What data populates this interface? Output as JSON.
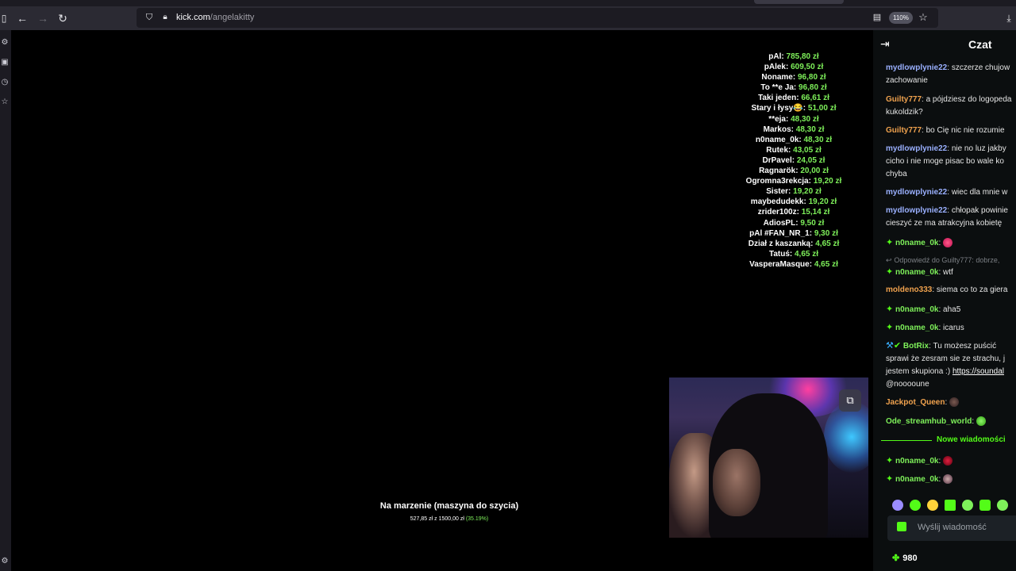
{
  "browser": {
    "url_domain": "kick.com",
    "url_path": "/angelakitty",
    "zoom": "110%",
    "icons": [
      "sidebar-toggle-icon",
      "back-icon",
      "forward-icon",
      "reload-icon",
      "tracking-shield-icon",
      "lock-icon",
      "reader-view-icon",
      "bookmark-star-icon",
      "downloads-icon"
    ]
  },
  "stream": {
    "donations": [
      {
        "name": "pAl:",
        "amount": "785,80 zł"
      },
      {
        "name": "pAlek:",
        "amount": "609,50 zł"
      },
      {
        "name": "Noname:",
        "amount": "96,80 zł"
      },
      {
        "name": "To **e Ja:",
        "amount": "96,80 zł"
      },
      {
        "name": "Taki jeden:",
        "amount": "66,61 zł"
      },
      {
        "name": "Stary i łysy😂:",
        "amount": "51,00 zł"
      },
      {
        "name": "**eja:",
        "amount": "48,30 zł"
      },
      {
        "name": "Markos:",
        "amount": "48,30 zł"
      },
      {
        "name": "n0name_0k:",
        "amount": "48,30 zł"
      },
      {
        "name": "Rutek:",
        "amount": "43,05 zł"
      },
      {
        "name": "DrPavel:",
        "amount": "24,05 zł"
      },
      {
        "name": "Ragnarök:",
        "amount": "20,00 zł"
      },
      {
        "name": "Ogromna3rekcja:",
        "amount": "19,20 zł"
      },
      {
        "name": "Sister:",
        "amount": "19,20 zł"
      },
      {
        "name": "maybedudekk:",
        "amount": "19,20 zł"
      },
      {
        "name": "zrider100z:",
        "amount": "15,14 zł"
      },
      {
        "name": "AdiosPL:",
        "amount": "9,50 zł"
      },
      {
        "name": "pAl #FAN_NR_1:",
        "amount": "9,30 zł"
      },
      {
        "name": "Dział z kaszanką:",
        "amount": "4,65 zł"
      },
      {
        "name": "Tatuś:",
        "amount": "4,65 zł"
      },
      {
        "name": "VasperaMasque:",
        "amount": "4,65 zł"
      }
    ],
    "goal": {
      "title": "Na marzenie (maszyna do szycia)",
      "progress_text": "527,85 zł z 1500,00 zł",
      "percent_text": "(35.19%)",
      "progress": 0.3519
    }
  },
  "chat": {
    "title": "Czat",
    "messages": {
      "m1_user": "mydlowplynie22",
      "m1_text1": "szczerze chujow",
      "m1_text2": "zachowanie",
      "m2_user": "Guilty777",
      "m2_text1": "a pójdziesz do logopeda",
      "m2_text2": "kukoldzik?",
      "m3_user": "Guilty777",
      "m3_text1": "bo Cię nic nie rozumie",
      "m4_user": "mydlowplynie22",
      "m4_text1": "nie no luz jakby",
      "m4_text2": "cicho i nie moge pisac bo wale ko",
      "m4_text3": "chyba",
      "m5_user": "mydlowplynie22",
      "m5_text1": "wiec dla mnie w",
      "m6_user": "mydlowplynie22",
      "m6_text1": "chłopak powinie",
      "m6_text2": "cieszyć ze ma atrakcyjna kobietę",
      "m7_user": "n0name_0k",
      "reply_text": "Odpowiedź do Guilty777: dobrze,",
      "m8_user": "n0name_0k",
      "m8_text1": "wtf",
      "m9_user": "moldeno333",
      "m9_text1": "siema co to za giera",
      "m10_user": "n0name_0k",
      "m10_text1": "aha5",
      "m11_user": "n0name_0k",
      "m11_text1": "icarus",
      "m12_user": "BotRix",
      "m12_text1": "Tu możesz puścić",
      "m12_text2": "sprawi że zesram sie ze strachu, j",
      "m12_text3": "jestem skupiona :)",
      "m12_link": "https://soundal",
      "m12_text4": "@nooooune",
      "m13_user": "Jackpot_Queen",
      "m14_user": "Ode_streamhub_world",
      "divider": "Nowe wiadomości",
      "m15_user": "n0name_0k",
      "m16_user": "n0name_0k"
    },
    "input_placeholder": "Wyślij wiadomość",
    "points": "980"
  },
  "colors": {
    "kick_green": "#53fc18",
    "donation_green": "#7ef05a",
    "chat_bg": "#0b0e0f",
    "browser_toolbar": "#2b2a33"
  }
}
